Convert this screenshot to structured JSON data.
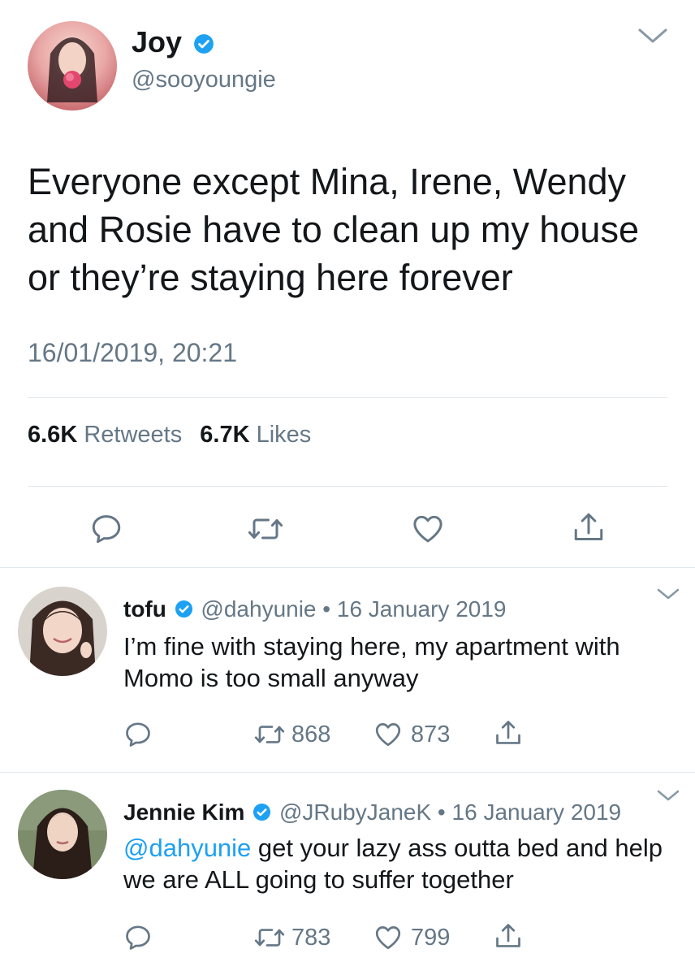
{
  "main_tweet": {
    "author_name": "Joy",
    "author_handle": "@sooyoungie",
    "text": "Everyone except Mina, Irene, Wendy and Rosie have to clean up my house or they’re staying here forever",
    "timestamp": "16/01/2019, 20:21",
    "retweets_count": "6.6K",
    "retweets_label": "Retweets",
    "likes_count": "6.7K",
    "likes_label": "Likes"
  },
  "replies": [
    {
      "author_name": "tofu",
      "author_handle": "@dahyunie",
      "separator": "•",
      "date": "16 January 2019",
      "mention": "",
      "text": "I’m fine with staying here, my apartment with Momo is too small anyway",
      "retweets": "868",
      "likes": "873"
    },
    {
      "author_name": "Jennie Kim",
      "author_handle": "@JRubyJaneK",
      "separator": "•",
      "date": "16 January 2019",
      "mention": "@dahyunie",
      "text": " get your lazy ass outta bed and help we are ALL going to suffer together",
      "retweets": "783",
      "likes": "799"
    }
  ],
  "colors": {
    "verified": "#1da1f2",
    "link": "#1da1f2",
    "muted": "#657786",
    "divider": "#e1e8ed"
  },
  "icons": [
    "chevron-down-icon",
    "reply-icon",
    "retweet-icon",
    "like-icon",
    "share-icon",
    "verified-badge-icon"
  ]
}
